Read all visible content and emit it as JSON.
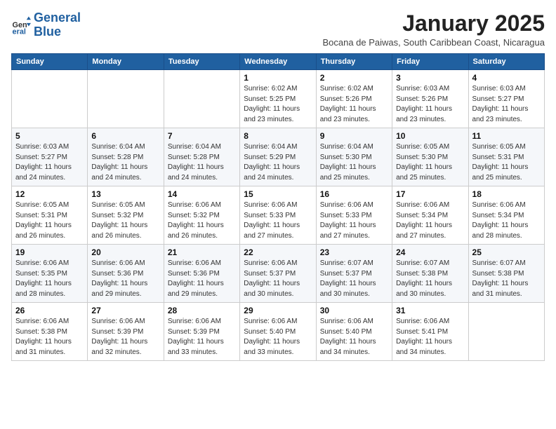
{
  "logo": {
    "text_general": "General",
    "text_blue": "Blue"
  },
  "title": "January 2025",
  "subtitle": "Bocana de Paiwas, South Caribbean Coast, Nicaragua",
  "headers": [
    "Sunday",
    "Monday",
    "Tuesday",
    "Wednesday",
    "Thursday",
    "Friday",
    "Saturday"
  ],
  "weeks": [
    [
      {
        "day": "",
        "info": ""
      },
      {
        "day": "",
        "info": ""
      },
      {
        "day": "",
        "info": ""
      },
      {
        "day": "1",
        "info": "Sunrise: 6:02 AM\nSunset: 5:25 PM\nDaylight: 11 hours\nand 23 minutes."
      },
      {
        "day": "2",
        "info": "Sunrise: 6:02 AM\nSunset: 5:26 PM\nDaylight: 11 hours\nand 23 minutes."
      },
      {
        "day": "3",
        "info": "Sunrise: 6:03 AM\nSunset: 5:26 PM\nDaylight: 11 hours\nand 23 minutes."
      },
      {
        "day": "4",
        "info": "Sunrise: 6:03 AM\nSunset: 5:27 PM\nDaylight: 11 hours\nand 23 minutes."
      }
    ],
    [
      {
        "day": "5",
        "info": "Sunrise: 6:03 AM\nSunset: 5:27 PM\nDaylight: 11 hours\nand 24 minutes."
      },
      {
        "day": "6",
        "info": "Sunrise: 6:04 AM\nSunset: 5:28 PM\nDaylight: 11 hours\nand 24 minutes."
      },
      {
        "day": "7",
        "info": "Sunrise: 6:04 AM\nSunset: 5:28 PM\nDaylight: 11 hours\nand 24 minutes."
      },
      {
        "day": "8",
        "info": "Sunrise: 6:04 AM\nSunset: 5:29 PM\nDaylight: 11 hours\nand 24 minutes."
      },
      {
        "day": "9",
        "info": "Sunrise: 6:04 AM\nSunset: 5:30 PM\nDaylight: 11 hours\nand 25 minutes."
      },
      {
        "day": "10",
        "info": "Sunrise: 6:05 AM\nSunset: 5:30 PM\nDaylight: 11 hours\nand 25 minutes."
      },
      {
        "day": "11",
        "info": "Sunrise: 6:05 AM\nSunset: 5:31 PM\nDaylight: 11 hours\nand 25 minutes."
      }
    ],
    [
      {
        "day": "12",
        "info": "Sunrise: 6:05 AM\nSunset: 5:31 PM\nDaylight: 11 hours\nand 26 minutes."
      },
      {
        "day": "13",
        "info": "Sunrise: 6:05 AM\nSunset: 5:32 PM\nDaylight: 11 hours\nand 26 minutes."
      },
      {
        "day": "14",
        "info": "Sunrise: 6:06 AM\nSunset: 5:32 PM\nDaylight: 11 hours\nand 26 minutes."
      },
      {
        "day": "15",
        "info": "Sunrise: 6:06 AM\nSunset: 5:33 PM\nDaylight: 11 hours\nand 27 minutes."
      },
      {
        "day": "16",
        "info": "Sunrise: 6:06 AM\nSunset: 5:33 PM\nDaylight: 11 hours\nand 27 minutes."
      },
      {
        "day": "17",
        "info": "Sunrise: 6:06 AM\nSunset: 5:34 PM\nDaylight: 11 hours\nand 27 minutes."
      },
      {
        "day": "18",
        "info": "Sunrise: 6:06 AM\nSunset: 5:34 PM\nDaylight: 11 hours\nand 28 minutes."
      }
    ],
    [
      {
        "day": "19",
        "info": "Sunrise: 6:06 AM\nSunset: 5:35 PM\nDaylight: 11 hours\nand 28 minutes."
      },
      {
        "day": "20",
        "info": "Sunrise: 6:06 AM\nSunset: 5:36 PM\nDaylight: 11 hours\nand 29 minutes."
      },
      {
        "day": "21",
        "info": "Sunrise: 6:06 AM\nSunset: 5:36 PM\nDaylight: 11 hours\nand 29 minutes."
      },
      {
        "day": "22",
        "info": "Sunrise: 6:06 AM\nSunset: 5:37 PM\nDaylight: 11 hours\nand 30 minutes."
      },
      {
        "day": "23",
        "info": "Sunrise: 6:07 AM\nSunset: 5:37 PM\nDaylight: 11 hours\nand 30 minutes."
      },
      {
        "day": "24",
        "info": "Sunrise: 6:07 AM\nSunset: 5:38 PM\nDaylight: 11 hours\nand 30 minutes."
      },
      {
        "day": "25",
        "info": "Sunrise: 6:07 AM\nSunset: 5:38 PM\nDaylight: 11 hours\nand 31 minutes."
      }
    ],
    [
      {
        "day": "26",
        "info": "Sunrise: 6:06 AM\nSunset: 5:38 PM\nDaylight: 11 hours\nand 31 minutes."
      },
      {
        "day": "27",
        "info": "Sunrise: 6:06 AM\nSunset: 5:39 PM\nDaylight: 11 hours\nand 32 minutes."
      },
      {
        "day": "28",
        "info": "Sunrise: 6:06 AM\nSunset: 5:39 PM\nDaylight: 11 hours\nand 33 minutes."
      },
      {
        "day": "29",
        "info": "Sunrise: 6:06 AM\nSunset: 5:40 PM\nDaylight: 11 hours\nand 33 minutes."
      },
      {
        "day": "30",
        "info": "Sunrise: 6:06 AM\nSunset: 5:40 PM\nDaylight: 11 hours\nand 34 minutes."
      },
      {
        "day": "31",
        "info": "Sunrise: 6:06 AM\nSunset: 5:41 PM\nDaylight: 11 hours\nand 34 minutes."
      },
      {
        "day": "",
        "info": ""
      }
    ]
  ]
}
